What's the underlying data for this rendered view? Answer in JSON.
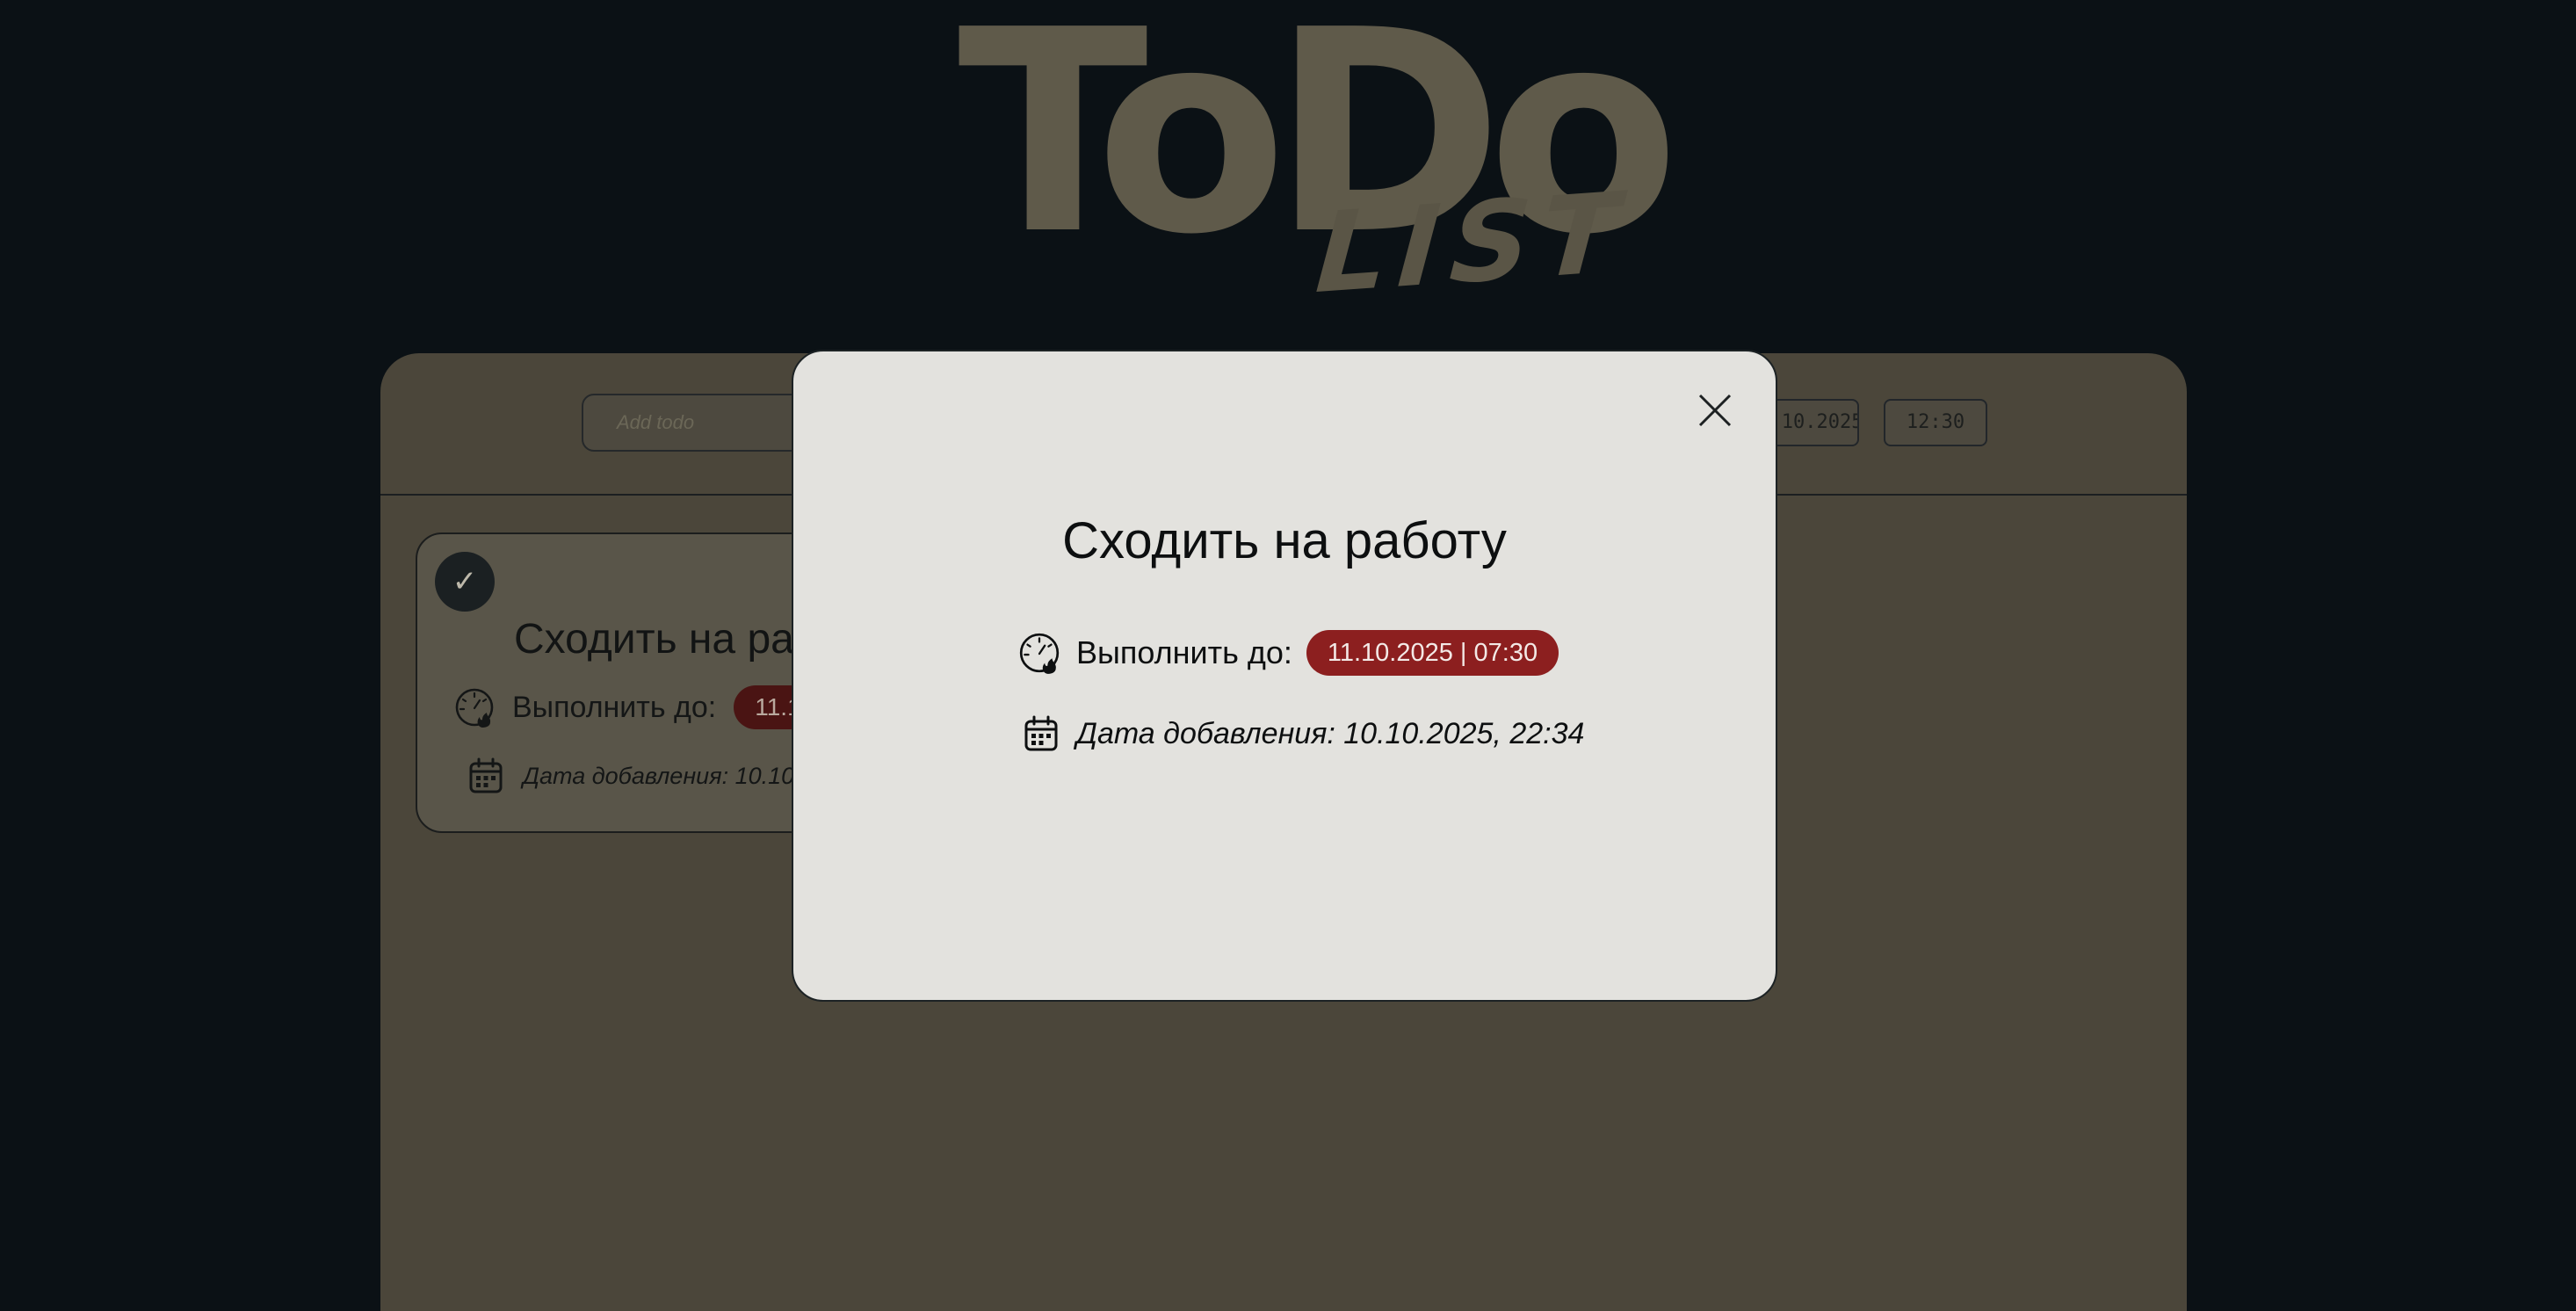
{
  "logo": {
    "title": "ToDo",
    "subtitle": "LIST"
  },
  "toolbar": {
    "add_placeholder": "Add todo",
    "date_value": "10.10.2025",
    "time_value": "12:30"
  },
  "todos": [
    {
      "title": "Сходить на работу",
      "due_label": "Выполнить до:",
      "due_value": "11.10.2025 | 07:30",
      "added_label": "Дата добавления: 10.10.2025, 22:34",
      "completed": true
    }
  ],
  "modal": {
    "title": "Сходить на работу",
    "due_label": "Выполнить до:",
    "due_value": "11.10.2025 | 07:30",
    "added_text": "Дата добавления: 10.10.2025, 22:34"
  },
  "icons": {
    "close": "close-icon",
    "deadline": "deadline-clock-fire-icon",
    "calendar": "calendar-icon",
    "check": "check-icon"
  },
  "colors": {
    "page_background": "#0b1115",
    "panel_background": "#4b463a",
    "modal_background": "#e3e2de",
    "due_badge": "#8c1f1f",
    "logo": "#5f5a4a"
  }
}
